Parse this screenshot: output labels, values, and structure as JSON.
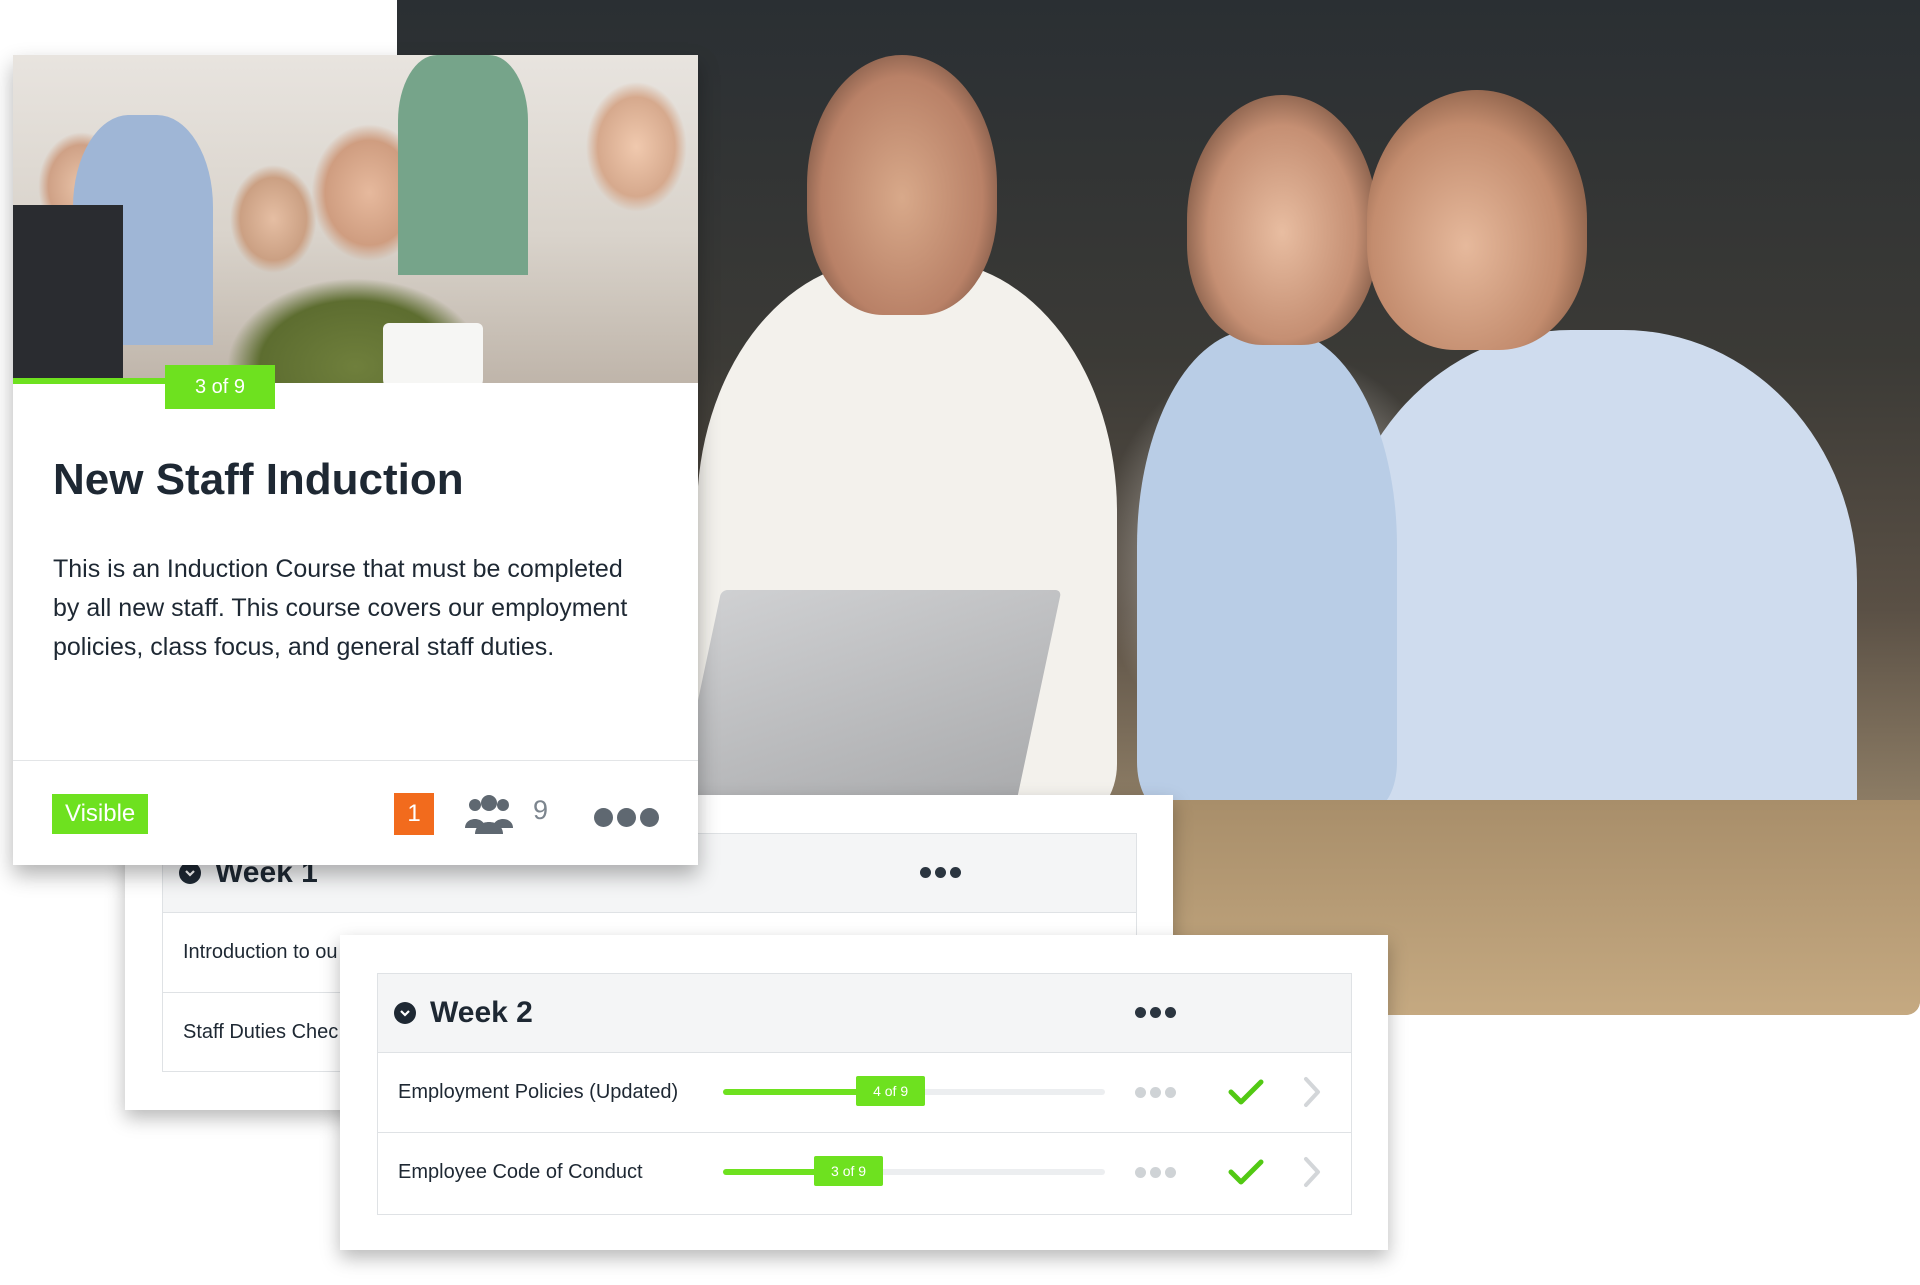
{
  "course": {
    "progress_label": "3 of 9",
    "progress": {
      "current": 3,
      "total": 9
    },
    "title": "New Staff Induction",
    "description": "This is an Induction Course that must be completed by all new staff. This course covers our employment policies, class focus, and general staff duties.",
    "status": "Visible",
    "notification_count": "1",
    "member_count": "9"
  },
  "week1": {
    "title": "Week 1",
    "rows": [
      {
        "title": "Introduction to ou"
      },
      {
        "title": "Staff Duties Chec"
      }
    ]
  },
  "week2": {
    "title": "Week 2",
    "rows": [
      {
        "title": "Employment Policies (Updated)",
        "progress_label": "4 of 9",
        "progress": 0.44
      },
      {
        "title": "Employee Code of Conduct",
        "progress_label": "3 of 9",
        "progress": 0.33
      }
    ]
  },
  "colors": {
    "accent_green": "#6ee11f",
    "badge_orange": "#f26b1d",
    "text_dark": "#1e2833"
  },
  "icons": {
    "chevron": "chevron-down-circle-icon",
    "more": "more-dots-icon",
    "complete": "check-icon",
    "open": "chevron-right-icon",
    "members": "group-icon"
  }
}
